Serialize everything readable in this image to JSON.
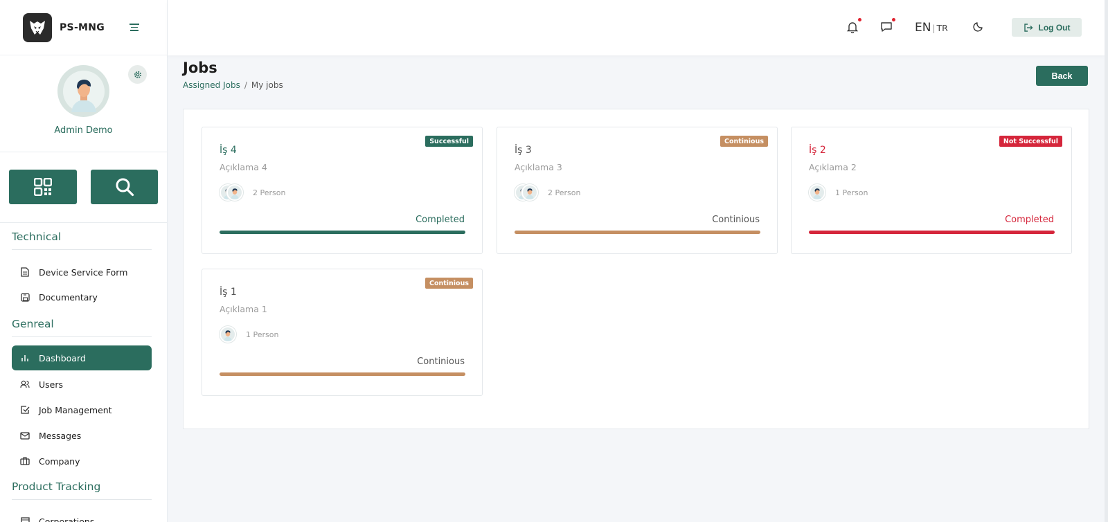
{
  "app": {
    "name": "PS-MNG"
  },
  "profile": {
    "name": "Admin Demo"
  },
  "sidebar": {
    "sections": [
      {
        "title": "Technical"
      },
      {
        "title": "Genreal"
      },
      {
        "title": "Product Tracking"
      }
    ],
    "items": [
      {
        "label": "Device Service Form",
        "icon": "document-icon"
      },
      {
        "label": "Documentary",
        "icon": "save-icon"
      },
      {
        "label": "Dashboard",
        "icon": "bar-chart-icon",
        "active": true
      },
      {
        "label": "Users",
        "icon": "users-icon"
      },
      {
        "label": "Job Management",
        "icon": "checkbox-icon"
      },
      {
        "label": "Messages",
        "icon": "mail-icon"
      },
      {
        "label": "Company",
        "icon": "briefcase-icon"
      },
      {
        "label": "Corporations",
        "icon": "building-icon"
      }
    ]
  },
  "topbar": {
    "lang_current": "EN",
    "lang_sep": "|",
    "lang_other": "TR",
    "logout_label": "Log Out"
  },
  "page": {
    "title": "Jobs",
    "breadcrumb": [
      "Assigned Jobs",
      "/",
      "My jobs"
    ],
    "back_label": "Back"
  },
  "colors": {
    "primary": "#2b6d5e",
    "continuous": "#c58f62",
    "danger": "#d5263b"
  },
  "jobs": [
    {
      "title": "İş 4",
      "description": "Açıklama 4",
      "badge": "Successful",
      "badge_color": "#2b6d5e",
      "title_color": "#2b6d5e",
      "persons": "2 Person",
      "avatar_count": 2,
      "status": "Completed",
      "status_color": "#2b6d5e",
      "progress": 1.0
    },
    {
      "title": "İş 3",
      "description": "Açıklama 3",
      "badge": "Continious",
      "badge_color": "#c58f62",
      "title_color": "#555555",
      "persons": "2 Person",
      "avatar_count": 2,
      "status": "Continious",
      "status_color": "#555555",
      "progress": 1.0
    },
    {
      "title": "İş 2",
      "description": "Açıklama 2",
      "badge": "Not Successful",
      "badge_color": "#d5263b",
      "title_color": "#d5263b",
      "persons": "1 Person",
      "avatar_count": 1,
      "status": "Completed",
      "status_color": "#d5263b",
      "progress": 1.0
    },
    {
      "title": "İş 1",
      "description": "Açıklama 1",
      "badge": "Continious",
      "badge_color": "#c58f62",
      "title_color": "#555555",
      "persons": "1 Person",
      "avatar_count": 1,
      "status": "Continious",
      "status_color": "#555555",
      "progress": 1.0
    }
  ]
}
